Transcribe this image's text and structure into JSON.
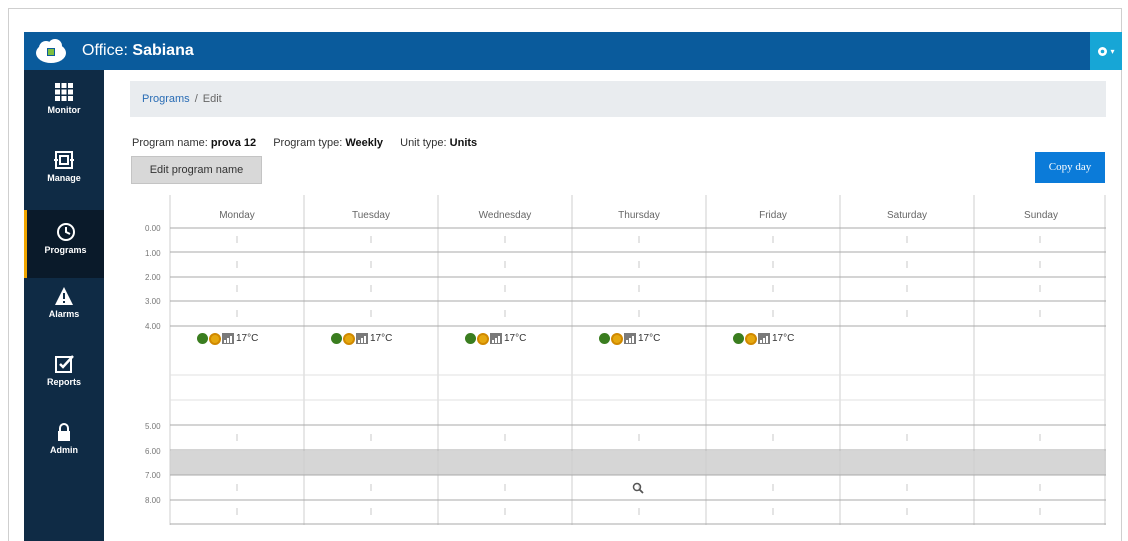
{
  "header": {
    "office_prefix": "Office: ",
    "office_name": "Sabiana",
    "user_menu_icon": "gear-icon"
  },
  "sidebar": {
    "items": [
      {
        "label": "Monitor",
        "icon": "grid-icon"
      },
      {
        "label": "Manage",
        "icon": "manage-icon"
      },
      {
        "label": "Programs",
        "icon": "clock-icon",
        "active": true
      },
      {
        "label": "Alarms",
        "icon": "warning-icon"
      },
      {
        "label": "Reports",
        "icon": "check-square-icon"
      },
      {
        "label": "Admin",
        "icon": "lock-icon"
      }
    ]
  },
  "breadcrumb": {
    "root": "Programs",
    "separator": "/",
    "current": "Edit"
  },
  "program": {
    "name_label": "Program name:",
    "name_value": "prova 12",
    "type_label": "Program type:",
    "type_value": "Weekly",
    "unit_label": "Unit type:",
    "unit_value": "Units"
  },
  "buttons": {
    "edit_name": "Edit program name",
    "copy_day": "Copy day"
  },
  "schedule": {
    "days": [
      "Monday",
      "Tuesday",
      "Wednesday",
      "Thursday",
      "Friday",
      "Saturday",
      "Sunday"
    ],
    "hours_top": [
      "0.00",
      "1.00",
      "2.00",
      "3.00",
      "4.00"
    ],
    "hours_bottom": [
      "5.00",
      "6.00",
      "7.00",
      "8.00"
    ],
    "event_temp": "17°C",
    "event_days": [
      "Monday",
      "Tuesday",
      "Wednesday",
      "Thursday",
      "Friday"
    ]
  },
  "colors": {
    "topbar": "#0a5b9c",
    "sidebar": "#0f2b45",
    "accent": "#f0a500",
    "primary_button": "#0b7bd9"
  }
}
